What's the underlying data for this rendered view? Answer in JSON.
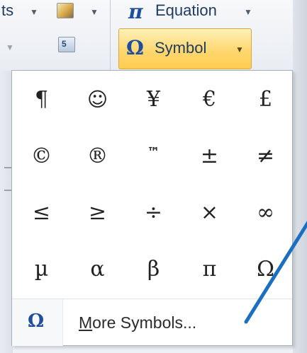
{
  "ribbon": {
    "partial_left_label": "ts",
    "equation_label": "Equation",
    "symbol_button_label": "Symbol"
  },
  "symbols": [
    "¶",
    "☺",
    "¥",
    "€",
    "£",
    "©",
    "®",
    "™",
    "±",
    "≠",
    "≤",
    "≥",
    "÷",
    "×",
    "∞",
    "µ",
    "α",
    "β",
    "π",
    "Ω"
  ],
  "more_symbols": {
    "label_first_char": "M",
    "label_rest": "ore Symbols..."
  },
  "icons": {
    "equation": "pi-icon",
    "symbol": "omega-icon",
    "dropdown": "chevron-down-icon"
  },
  "colors": {
    "accent_blue": "#1d4f9e",
    "symbol_button_fill": "#ffd770",
    "annotation_line": "#1b6fc2"
  }
}
